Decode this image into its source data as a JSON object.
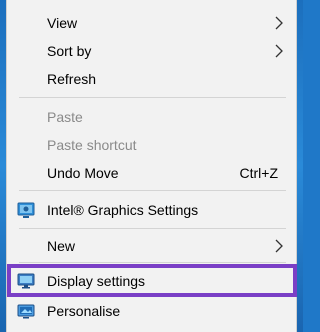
{
  "menu": {
    "items": [
      {
        "label": "View",
        "submenu": true,
        "disabled": false
      },
      {
        "label": "Sort by",
        "submenu": true,
        "disabled": false
      },
      {
        "label": "Refresh",
        "disabled": false
      },
      {
        "label": "Paste",
        "disabled": true
      },
      {
        "label": "Paste shortcut",
        "disabled": true
      },
      {
        "label": "Undo Move",
        "shortcut": "Ctrl+Z",
        "disabled": false
      },
      {
        "label": "Intel® Graphics Settings",
        "icon": "intel-graphics-icon",
        "disabled": false
      },
      {
        "label": "New",
        "submenu": true,
        "disabled": false
      },
      {
        "label": "Display settings",
        "icon": "display-icon",
        "disabled": false,
        "highlighted": true
      },
      {
        "label": "Personalise",
        "icon": "personalise-icon",
        "disabled": false
      }
    ]
  },
  "colors": {
    "menu_background": "#f2f2f2",
    "highlight_border": "#7a3fc6",
    "disabled_text": "#8a8a8a",
    "desktop": "#1f78c8"
  }
}
